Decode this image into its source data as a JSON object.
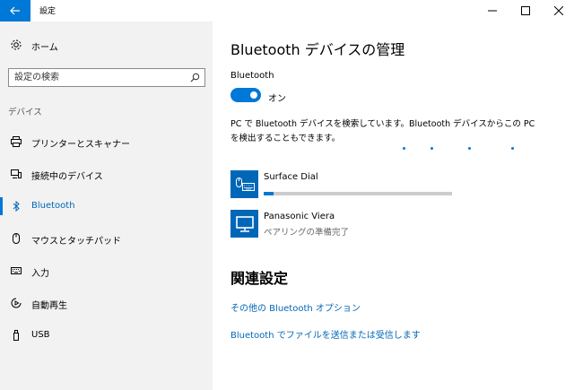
{
  "window": {
    "title": "設定"
  },
  "nav": {
    "home_label": "ホーム",
    "search_placeholder": "設定の検索",
    "section_label": "デバイス",
    "items": [
      {
        "label": "プリンターとスキャナー",
        "icon": "printer-icon"
      },
      {
        "label": "接続中のデバイス",
        "icon": "connected-devices-icon"
      },
      {
        "label": "Bluetooth",
        "icon": "bluetooth-icon",
        "active": true
      },
      {
        "label": "マウスとタッチパッド",
        "icon": "mouse-icon"
      },
      {
        "label": "入力",
        "icon": "keyboard-icon"
      },
      {
        "label": "自動再生",
        "icon": "autoplay-icon"
      },
      {
        "label": "USB",
        "icon": "usb-icon"
      }
    ]
  },
  "main": {
    "title": "Bluetooth デバイスの管理",
    "bluetooth_label": "Bluetooth",
    "toggle_state": "オン",
    "discover_text": "PC で Bluetooth デバイスを検索しています。Bluetooth デバイスからこの PC を検出することもできます。",
    "devices": [
      {
        "name": "Surface Dial",
        "icon": "mouse-keyboard-device-icon",
        "progress": 0.05
      },
      {
        "name": "Panasonic Viera",
        "status": "ペアリングの準備完了",
        "icon": "monitor-device-icon"
      }
    ],
    "related_title": "関連設定",
    "links": [
      "その他の Bluetooth オプション",
      "Bluetooth でファイルを送信または受信します"
    ]
  },
  "colors": {
    "accent": "#0078d7",
    "link": "#0067b8",
    "nav_bg": "#f2f2f2"
  }
}
